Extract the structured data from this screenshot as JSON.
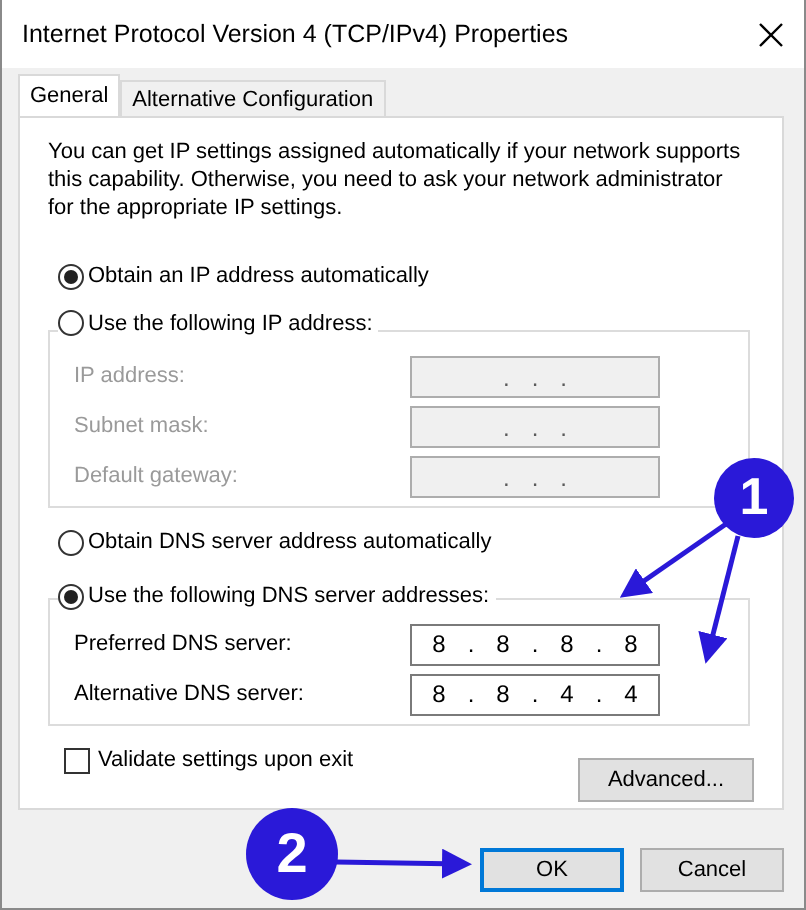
{
  "window": {
    "title": "Internet Protocol Version 4 (TCP/IPv4) Properties"
  },
  "tabs": [
    {
      "label": "General",
      "selected": true
    },
    {
      "label": "Alternative Configuration",
      "selected": false
    }
  ],
  "description": "You can get IP settings assigned automatically if your network supports this capability. Otherwise, you need to ask your network administrator for the appropriate IP settings.",
  "ip_options": [
    {
      "label": "Obtain an IP address automatically",
      "selected": true
    },
    {
      "label": "Use the following IP address:",
      "selected": false
    }
  ],
  "ip_fields": [
    {
      "label": "IP address:",
      "value": "...",
      "disabled": true
    },
    {
      "label": "Subnet mask:",
      "value": "...",
      "disabled": true
    },
    {
      "label": "Default gateway:",
      "value": "...",
      "disabled": true
    }
  ],
  "dns_options": [
    {
      "label": "Obtain DNS server address automatically",
      "selected": false
    },
    {
      "label": "Use the following DNS server addresses:",
      "selected": true
    }
  ],
  "dns_fields": [
    {
      "label": "Preferred DNS server:",
      "value": "8.8.8.8",
      "disabled": false
    },
    {
      "label": "Alternative DNS server:",
      "value": "8.8.4.4",
      "disabled": false
    }
  ],
  "validate": {
    "label": "Validate settings upon exit",
    "checked": false
  },
  "advanced_button": "Advanced...",
  "buttons": [
    {
      "label": "OK",
      "default": true
    },
    {
      "label": "Cancel",
      "default": false
    }
  ],
  "callouts": [
    {
      "number": "1"
    },
    {
      "number": "2"
    }
  ]
}
